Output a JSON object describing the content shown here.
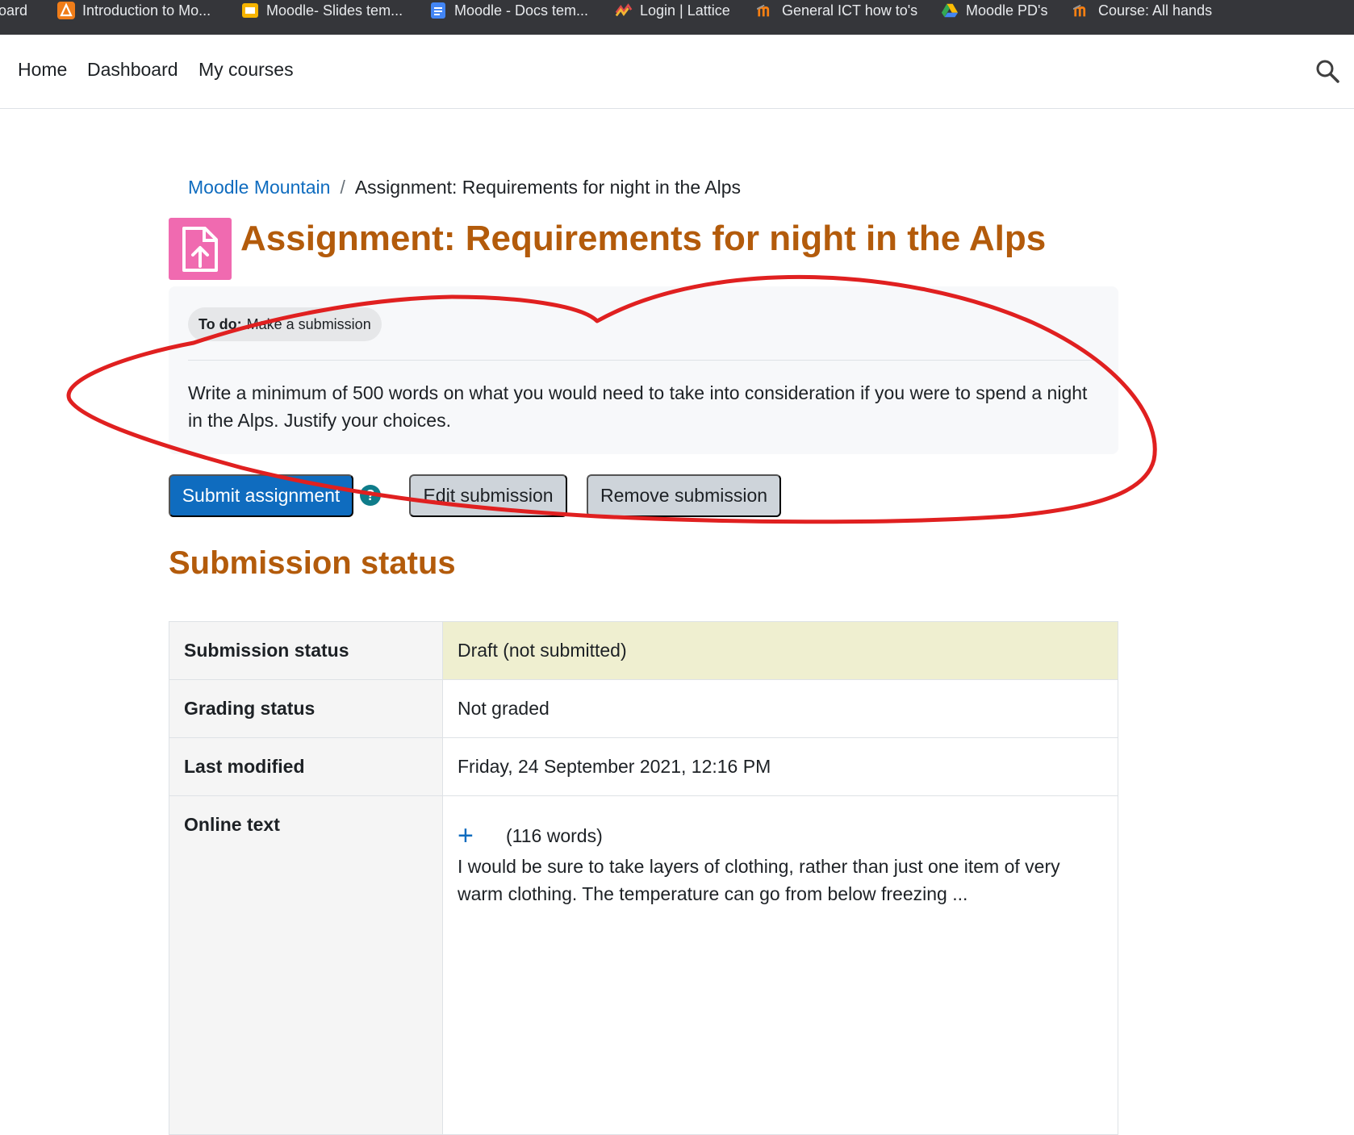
{
  "bookmarks": [
    {
      "label": "oard",
      "icon": "none"
    },
    {
      "label": "Introduction to Mo...",
      "icon": "triangle-logo-icon"
    },
    {
      "label": "Moodle- Slides tem...",
      "icon": "slides-icon"
    },
    {
      "label": "Moodle - Docs tem...",
      "icon": "docs-icon"
    },
    {
      "label": "Login | Lattice",
      "icon": "lattice-icon"
    },
    {
      "label": "General ICT how to's",
      "icon": "moodle-icon"
    },
    {
      "label": "Moodle PD's",
      "icon": "drive-icon"
    },
    {
      "label": "Course: All hands",
      "icon": "moodle-icon"
    }
  ],
  "nav": {
    "home": "Home",
    "dashboard": "Dashboard",
    "my_courses": "My courses"
  },
  "breadcrumb": {
    "course": "Moodle Mountain",
    "current": "Assignment: Requirements for night in the Alps"
  },
  "page": {
    "title": "Assignment: Requirements for night in the Alps",
    "todo_label": "To do:",
    "todo_text": "Make a submission",
    "intro": "Write a minimum of 500 words on what you would need to take into consideration if you were to spend a night in the Alps. Justify your choices."
  },
  "buttons": {
    "submit": "Submit assignment",
    "help": "?",
    "edit": "Edit submission",
    "remove": "Remove submission"
  },
  "submission": {
    "heading": "Submission status",
    "rows": [
      {
        "label": "Submission status",
        "value": "Draft (not submitted)"
      },
      {
        "label": "Grading status",
        "value": "Not graded"
      },
      {
        "label": "Last modified",
        "value": "Friday, 24 September 2021, 12:16 PM"
      },
      {
        "label": "Online text",
        "plus": "+",
        "word_count": "(116 words)",
        "excerpt": "I would be sure to take layers of clothing, rather than just one item of very warm clothing. The temperature can go from below freezing ..."
      }
    ]
  },
  "colors": {
    "brand_blue": "#0f6cbf",
    "heading_orange": "#b35b0b",
    "module_pink": "#f06ab0",
    "draft_bg": "#efefd0",
    "annotation_red": "#e02020"
  }
}
